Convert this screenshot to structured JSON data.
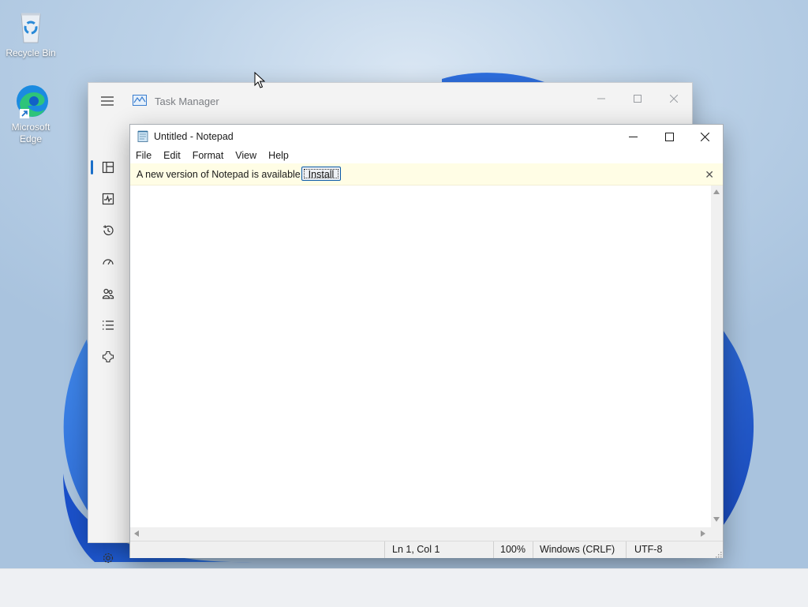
{
  "desktop": {
    "icons": [
      {
        "label": "Recycle Bin",
        "icon": "recycle-bin-icon"
      },
      {
        "label": "Microsoft Edge",
        "icon": "edge-icon"
      }
    ]
  },
  "task_manager": {
    "title": "Task Manager",
    "nav_icons": [
      "hamburger-icon",
      "processes-icon",
      "performance-icon",
      "app-history-icon",
      "startup-apps-icon",
      "users-icon",
      "details-icon",
      "services-icon",
      "settings-icon"
    ]
  },
  "notepad": {
    "title": "Untitled - Notepad",
    "menu": [
      "File",
      "Edit",
      "Format",
      "View",
      "Help"
    ],
    "infobar": {
      "message": "A new version of Notepad is available.",
      "button": "Install",
      "close": "✕"
    },
    "status": {
      "position": "Ln 1, Col 1",
      "zoom": "100%",
      "line_ending": "Windows (CRLF)",
      "encoding": "UTF-8"
    }
  },
  "colors": {
    "accent": "#1a6fc9",
    "infobar": "#fffde5",
    "wallpaper_bloom": "#1f5fd6"
  }
}
